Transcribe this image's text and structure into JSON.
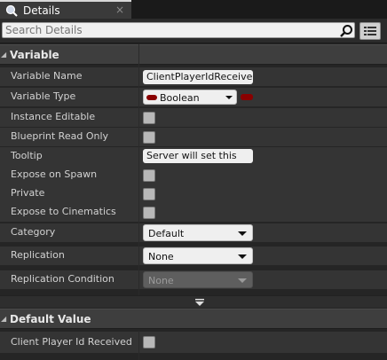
{
  "tab": {
    "title": "Details",
    "close": "×",
    "icon": "details-magnifier-icon"
  },
  "search": {
    "placeholder": "Search Details"
  },
  "sections": {
    "variable": {
      "title": "Variable"
    },
    "default_value": {
      "title": "Default Value"
    }
  },
  "fields": {
    "variable_name": {
      "label": "Variable Name",
      "value": "ClientPlayerIdReceived"
    },
    "variable_type": {
      "label": "Variable Type",
      "value": "Boolean",
      "pin_color": "#8a0000"
    },
    "instance_editable": {
      "label": "Instance Editable",
      "checked": false
    },
    "blueprint_read_only": {
      "label": "Blueprint Read Only",
      "checked": false
    },
    "tooltip": {
      "label": "Tooltip",
      "value": "Server will set this"
    },
    "expose_on_spawn": {
      "label": "Expose on Spawn",
      "checked": false
    },
    "private": {
      "label": "Private",
      "checked": false
    },
    "expose_to_cinematics": {
      "label": "Expose to Cinematics",
      "checked": false
    },
    "category": {
      "label": "Category",
      "value": "Default"
    },
    "replication": {
      "label": "Replication",
      "value": "None"
    },
    "replication_condition": {
      "label": "Replication Condition",
      "value": "None",
      "disabled": true
    },
    "client_player_id_received": {
      "label": "Client Player Id Received",
      "checked": false
    }
  },
  "colors": {
    "panel_bg": "#252525",
    "row_bg": "#343434",
    "header_bg": "#3e3e3e",
    "type_pin": "#8a0000"
  }
}
